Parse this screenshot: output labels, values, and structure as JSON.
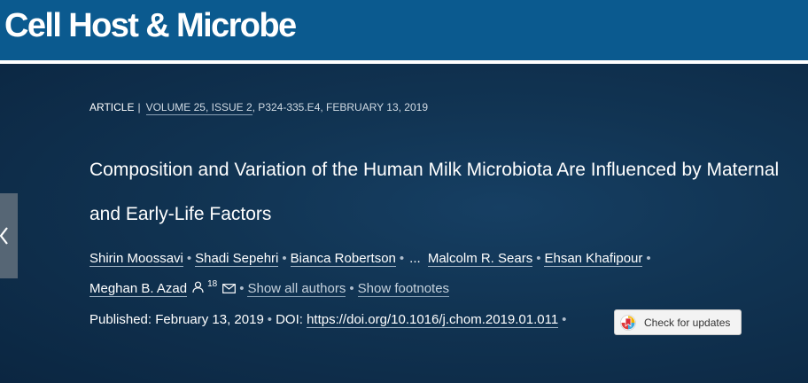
{
  "header": {
    "journal_title": "Cell Host & Microbe"
  },
  "article": {
    "type": "ARTICLE",
    "type_separator": "|",
    "volume_issue": "VOLUME 25, ISSUE 2",
    "pages_date": ", P324-335.E4, FEBRUARY 13, 2019",
    "title": "Composition and Variation of the Human Milk Microbiota Are Influenced by Maternal and Early-Life Factors"
  },
  "authors": {
    "list": [
      "Shirin Moossavi",
      "Shadi Sepehri",
      "Bianca Robertson",
      "Malcolm R. Sears",
      "Ehsan Khafipour",
      "Meghan B. Azad"
    ],
    "ellipsis": "...",
    "separator": "•",
    "corresponding_count": "18",
    "show_all_label": "Show all authors",
    "show_footnotes_label": "Show footnotes"
  },
  "publication": {
    "published_label": "Published: February 13, 2019",
    "doi_label": "DOI:",
    "doi_url": "https://doi.org/10.1016/j.chom.2019.01.011",
    "check_updates_label": "Check for updates"
  },
  "icons": {
    "side_tab": "chevron-left-icon",
    "person": "person-icon",
    "mail": "mail-icon",
    "updates": "crossmark-icon"
  },
  "colors": {
    "header_bg": "#0b5a8f",
    "hero_bg": "#113453",
    "text": "#ffffff"
  }
}
